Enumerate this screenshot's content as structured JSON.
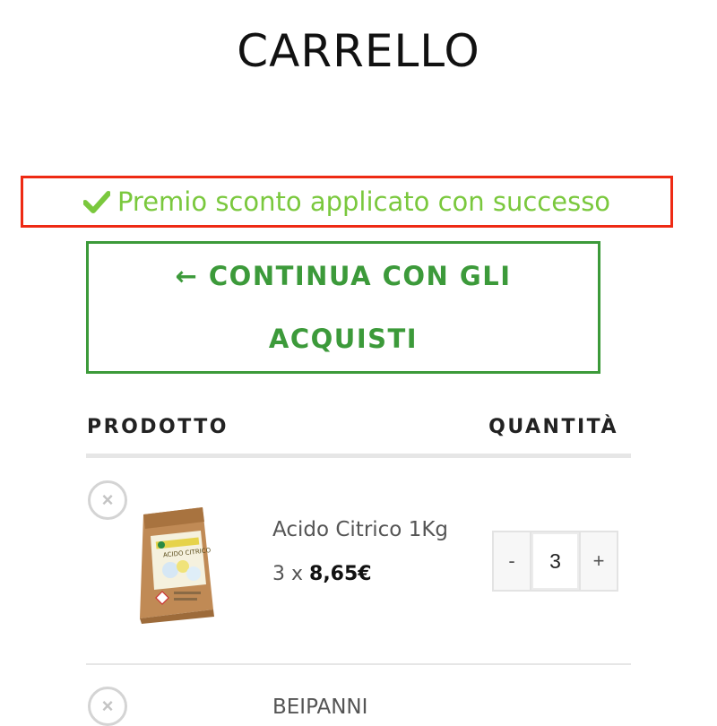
{
  "page": {
    "title": "CARRELLO"
  },
  "notice": {
    "text": "Premio sconto applicato con successo",
    "color": "#7ac83d",
    "icon": "check-icon"
  },
  "continue_button": {
    "line1": "← CONTINUA CON GLI",
    "line2": "ACQUISTI"
  },
  "table": {
    "col_product": "PRODOTTO",
    "col_quantity": "QUANTITÀ"
  },
  "items": [
    {
      "name": "Acido Citrico 1Kg",
      "qty_prefix": "3 x",
      "price": "8,65€",
      "quantity": "3",
      "minus": "-",
      "plus": "+",
      "remove": "×",
      "image_label": "ACIDO CITRICO"
    },
    {
      "name": "BEIPANNI",
      "remove": "×"
    }
  ]
}
